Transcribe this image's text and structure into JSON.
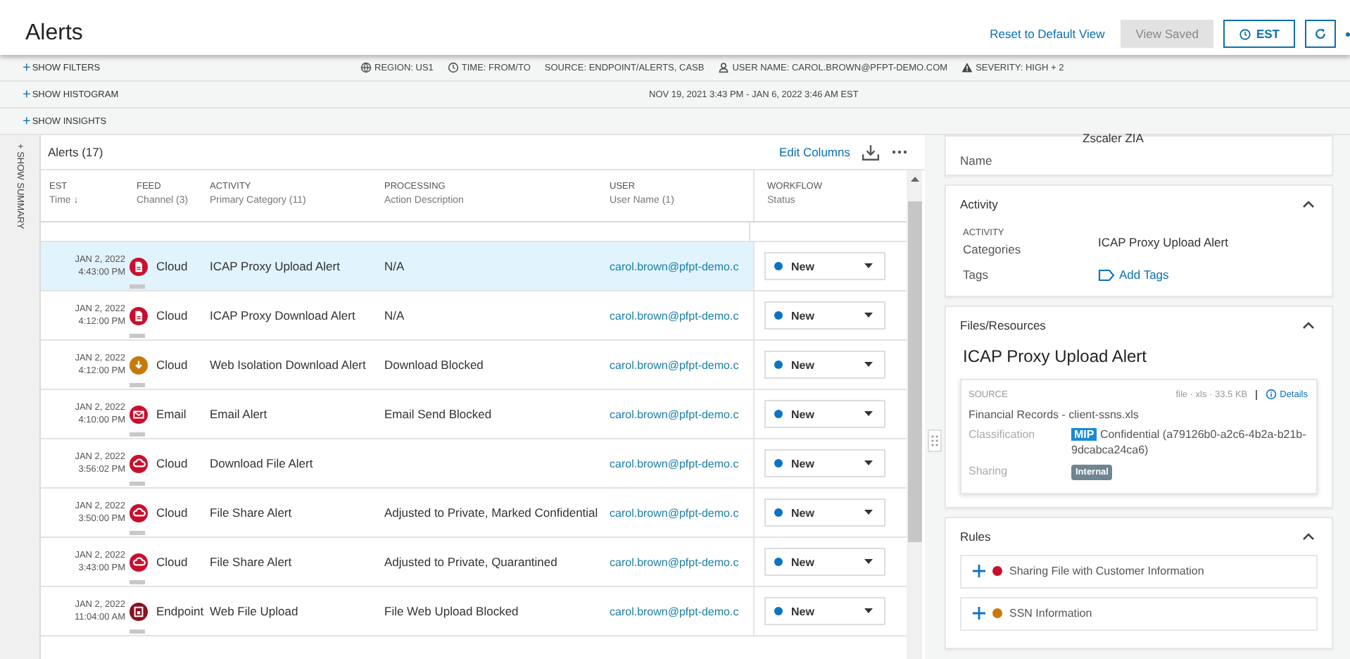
{
  "header": {
    "title": "Alerts",
    "reset_link": "Reset to Default View",
    "view_saved": {
      "label": "View Saved",
      "disabled": true
    },
    "timezone_button": "EST"
  },
  "filter_bar": {
    "toggles": [
      {
        "icon": "+",
        "label": "SHOW FILTERS"
      },
      {
        "icon": "+",
        "label": "SHOW HISTOGRAM"
      },
      {
        "icon": "+",
        "label": "SHOW INSIGHTS"
      }
    ],
    "filters": [
      {
        "kind": "globe",
        "text": "REGION: US1"
      },
      {
        "kind": "clock",
        "text": "TIME: FROM/TO"
      },
      {
        "kind": "none",
        "text": "SOURCE: ENDPOINT/ALERTS, CASB"
      },
      {
        "kind": "user",
        "text": "USER NAME: CAROL.BROWN@PFPT-DEMO.COM"
      },
      {
        "kind": "warning",
        "text": "SEVERITY: HIGH + 2"
      }
    ],
    "date_range": "NOV 19, 2021 3:43 PM - JAN 6, 2022 3:46 AM  EST"
  },
  "summary_toggle": {
    "icon": "+",
    "label": "SHOW SUMMARY"
  },
  "alerts": {
    "title": "Alerts (17)",
    "edit_columns": "Edit Columns",
    "columns": [
      {
        "top": "EST",
        "bottom": "Time ↓"
      },
      {
        "top": "FEED",
        "bottom": "Channel (3)"
      },
      {
        "top": "ACTIVITY",
        "bottom": "Primary Category (11)"
      },
      {
        "top": "PROCESSING",
        "bottom": "Action Description"
      },
      {
        "top": "USER",
        "bottom": "User Name (1)"
      },
      {
        "top": "WORKFLOW",
        "bottom": "Status"
      }
    ],
    "rows": [
      {
        "date": "JAN 2, 2022",
        "time": "4:43:00 PM",
        "kind": "document",
        "color": "#c8102e",
        "feed": "Cloud",
        "activity": "ICAP Proxy Upload Alert",
        "processing": "N/A",
        "user": "carol.brown@pfpt-demo.c",
        "status": "New",
        "selected": true
      },
      {
        "date": "JAN 2, 2022",
        "time": "4:12:00 PM",
        "kind": "document",
        "color": "#c8102e",
        "feed": "Cloud",
        "activity": "ICAP Proxy Download Alert",
        "processing": "N/A",
        "user": "carol.brown@pfpt-demo.c",
        "status": "New",
        "selected": false
      },
      {
        "date": "JAN 2, 2022",
        "time": "4:12:00 PM",
        "kind": "download",
        "color": "#c77a0a",
        "feed": "Cloud",
        "activity": "Web Isolation Download Alert",
        "processing": "Download Blocked",
        "user": "carol.brown@pfpt-demo.c",
        "status": "New",
        "selected": false
      },
      {
        "date": "JAN 2, 2022",
        "time": "4:10:00 PM",
        "kind": "email",
        "color": "#c8102e",
        "feed": "Email",
        "activity": "Email Alert",
        "processing": "Email Send Blocked",
        "user": "carol.brown@pfpt-demo.c",
        "status": "New",
        "selected": false
      },
      {
        "date": "JAN 2, 2022",
        "time": "3:56:02 PM",
        "kind": "cloud",
        "color": "#c8102e",
        "feed": "Cloud",
        "activity": "Download File Alert",
        "user": "carol.brown@pfpt-demo.c",
        "status": "New",
        "selected": false
      },
      {
        "date": "JAN 2, 2022",
        "time": "3:50:00 PM",
        "kind": "cloud",
        "color": "#c8102e",
        "feed": "Cloud",
        "activity": "File Share Alert",
        "processing": "Adjusted to Private, Marked Confidential",
        "user": "carol.brown@pfpt-demo.c",
        "status": "New",
        "selected": false
      },
      {
        "date": "JAN 2, 2022",
        "time": "3:43:00 PM",
        "kind": "cloud",
        "color": "#c8102e",
        "feed": "Cloud",
        "activity": "File Share Alert",
        "processing": "Adjusted to Private, Quarantined",
        "user": "carol.brown@pfpt-demo.c",
        "status": "New",
        "selected": false
      },
      {
        "date": "JAN 2, 2022",
        "time": "11:04:00 AM",
        "kind": "endpoint",
        "color": "#8a1020",
        "feed": "Endpoint",
        "activity": "Web File Upload",
        "processing": "File Web Upload Blocked",
        "user": "carol.brown@pfpt-demo.c",
        "status": "New",
        "selected": false
      }
    ]
  },
  "details": {
    "name_label": "Name",
    "name_value": "Zscaler ZIA",
    "activity": {
      "title": "Activity",
      "label_top": "ACTIVITY",
      "label": "Categories",
      "value": "ICAP Proxy Upload Alert",
      "tags_label": "Tags",
      "add_tags": "Add Tags"
    },
    "files": {
      "title": "Files/Resources",
      "heading": "ICAP Proxy Upload Alert",
      "source_label": "SOURCE",
      "meta": "file  ·  xls  ·  33.5 KB",
      "details_link": "Details",
      "file_name": "Financial Records - client-ssns.xls",
      "classification_label": "Classification",
      "mip": "MIP",
      "classification": "Confidential (a79126b0-a2c6-4b2a-b21b-9dcabca24ca6)",
      "sharing_label": "Sharing",
      "sharing": "Internal"
    },
    "rules": {
      "title": "Rules",
      "items": [
        {
          "label": "Sharing File with Customer Information",
          "color": "#c8102e"
        },
        {
          "label": "SSN Information",
          "color": "#c77a0a"
        }
      ]
    }
  }
}
